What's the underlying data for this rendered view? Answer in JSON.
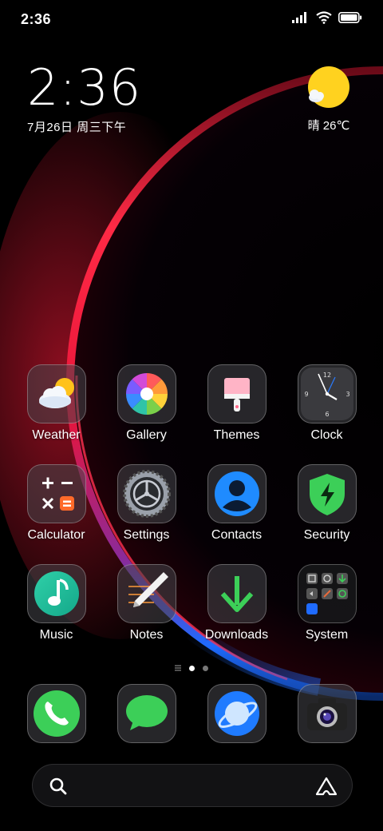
{
  "status_bar": {
    "time": "2:36",
    "icons": [
      "signal-icon",
      "wifi-icon",
      "battery-icon"
    ]
  },
  "clock_widget": {
    "time": "2:36",
    "date": "7月26日 周三下午"
  },
  "weather_widget": {
    "condition": "晴 26℃",
    "icon": "sunny-icon"
  },
  "apps": [
    {
      "label": "Weather",
      "icon": "weather-icon"
    },
    {
      "label": "Gallery",
      "icon": "gallery-icon"
    },
    {
      "label": "Themes",
      "icon": "themes-icon"
    },
    {
      "label": "Clock",
      "icon": "clock-icon"
    },
    {
      "label": "Calculator",
      "icon": "calculator-icon"
    },
    {
      "label": "Settings",
      "icon": "settings-icon"
    },
    {
      "label": "Contacts",
      "icon": "contacts-icon"
    },
    {
      "label": "Security",
      "icon": "security-icon"
    },
    {
      "label": "Music",
      "icon": "music-icon"
    },
    {
      "label": "Notes",
      "icon": "notes-icon"
    },
    {
      "label": "Downloads",
      "icon": "downloads-icon"
    },
    {
      "label": "System",
      "icon": "system-folder-icon"
    }
  ],
  "page_indicator": {
    "pages": 2,
    "current": 1
  },
  "dock": [
    {
      "icon": "phone-icon"
    },
    {
      "icon": "messages-icon"
    },
    {
      "icon": "browser-icon"
    },
    {
      "icon": "camera-icon"
    }
  ],
  "search_bar": {
    "icon": "search-icon",
    "assistant_icon": "assistant-icon"
  },
  "colors": {
    "accent_sun": "#FFD21F",
    "wallpaper_red": "#E8153A",
    "wallpaper_blue": "#1E6BFF"
  }
}
